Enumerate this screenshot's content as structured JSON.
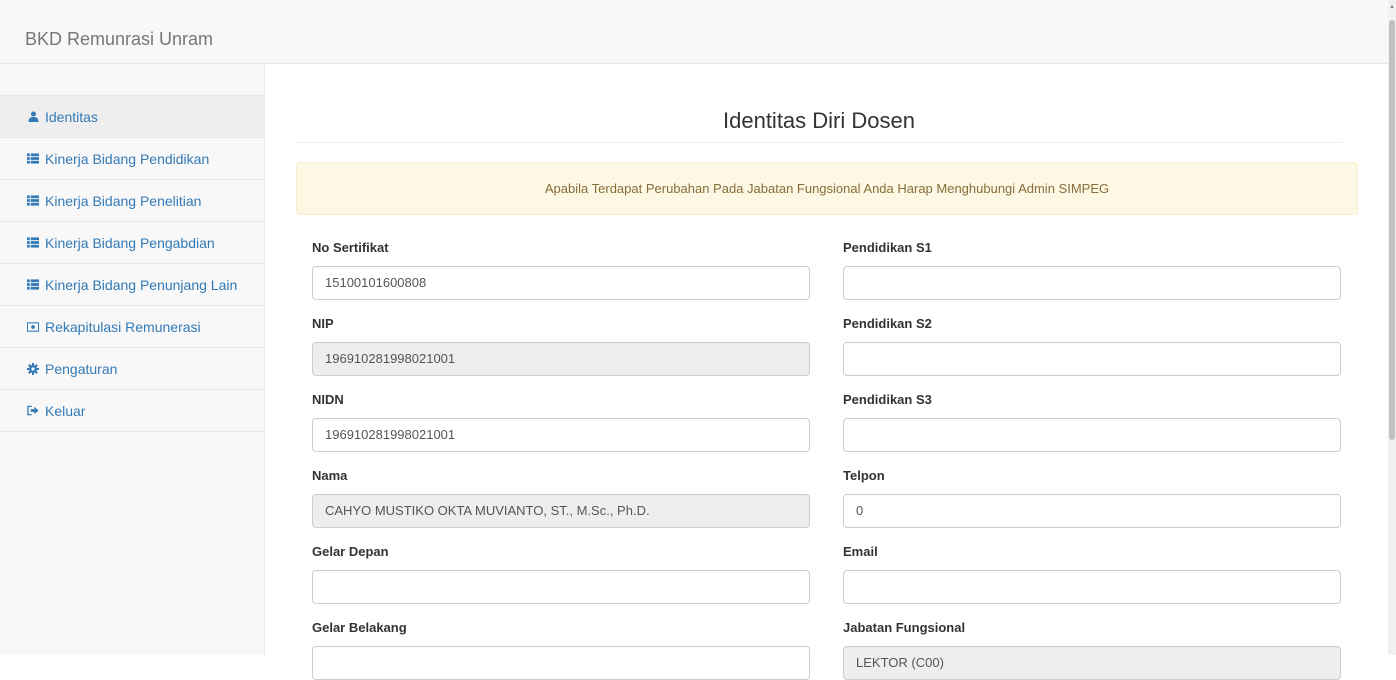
{
  "app": {
    "brand": "BKD Remunrasi Unram"
  },
  "sidebar": {
    "items": [
      {
        "label": "Identitas",
        "icon": "user-icon",
        "active": true
      },
      {
        "label": "Kinerja Bidang Pendidikan",
        "icon": "list-icon"
      },
      {
        "label": "Kinerja Bidang Penelitian",
        "icon": "list-icon"
      },
      {
        "label": "Kinerja Bidang Pengabdian",
        "icon": "list-icon"
      },
      {
        "label": "Kinerja Bidang Penunjang Lain",
        "icon": "list-icon"
      },
      {
        "label": "Rekapitulasi Remunerasi",
        "icon": "money-icon"
      },
      {
        "label": "Pengaturan",
        "icon": "gear-icon"
      },
      {
        "label": "Keluar",
        "icon": "logout-icon"
      }
    ]
  },
  "page": {
    "title": "Identitas Diri Dosen",
    "alert": "Apabila Terdapat Perubahan Pada Jabatan Fungsional Anda Harap Menghubungi Admin SIMPEG"
  },
  "form": {
    "no_sertifikat": {
      "label": "No Sertifikat",
      "value": "15100101600808"
    },
    "nip": {
      "label": "NIP",
      "value": "196910281998021001"
    },
    "nidn": {
      "label": "NIDN",
      "value": "196910281998021001"
    },
    "nama": {
      "label": "Nama",
      "value": "CAHYO MUSTIKO OKTA MUVIANTO, ST., M.Sc., Ph.D."
    },
    "gelar_depan": {
      "label": "Gelar Depan",
      "value": ""
    },
    "gelar_belakang": {
      "label": "Gelar Belakang",
      "value": ""
    },
    "pendidikan_s1": {
      "label": "Pendidikan S1",
      "value": ""
    },
    "pendidikan_s2": {
      "label": "Pendidikan S2",
      "value": ""
    },
    "pendidikan_s3": {
      "label": "Pendidikan S3",
      "value": ""
    },
    "telpon": {
      "label": "Telpon",
      "value": "0"
    },
    "email": {
      "label": "Email",
      "value": ""
    },
    "jabatan_fungsional": {
      "label": "Jabatan Fungsional",
      "value": "LEKTOR (C00)"
    }
  },
  "colors": {
    "link": "#337ab7",
    "alert_bg": "#fcf8e3",
    "alert_text": "#8a6d3b",
    "readonly_bg": "#eeeeee"
  }
}
